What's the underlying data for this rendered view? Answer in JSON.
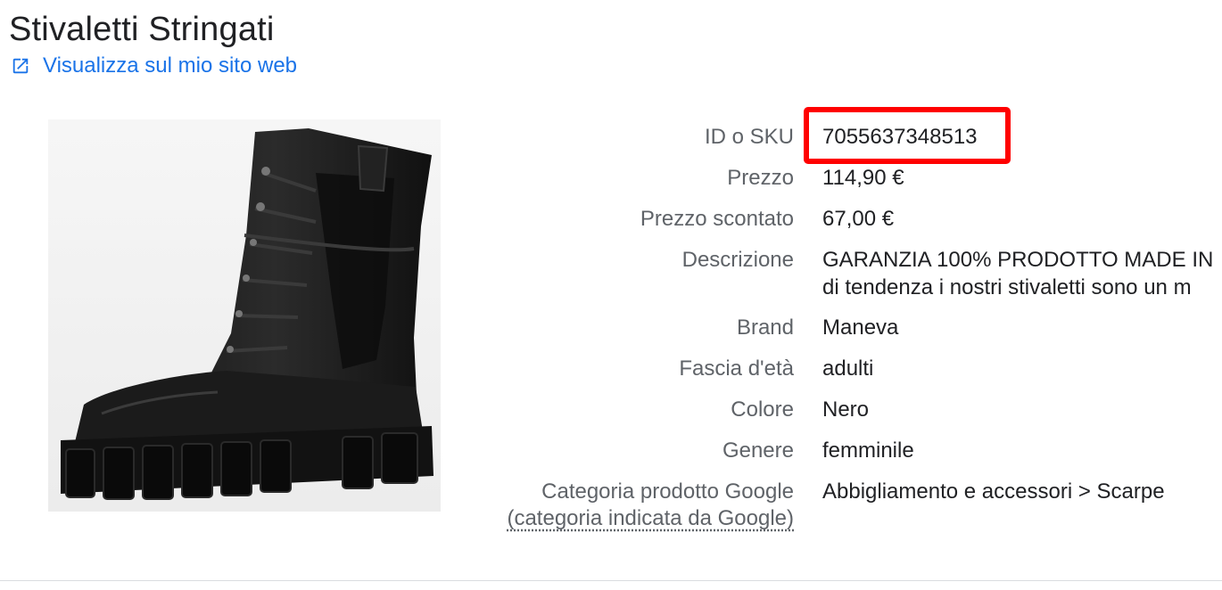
{
  "product": {
    "title": "Stivaletti Stringati",
    "view_link_label": "Visualizza sul mio sito web",
    "image_icon": "black-lace-up-boot-image"
  },
  "details": {
    "sku_label": "ID o SKU",
    "sku_value": "7055637348513",
    "price_label": "Prezzo",
    "price_value": "114,90 €",
    "sale_price_label": "Prezzo scontato",
    "sale_price_value": "67,00 €",
    "description_label": "Descrizione",
    "description_line1": "GARANZIA 100% PRODOTTO MADE IN",
    "description_line2": "di tendenza i nostri stivaletti sono un m",
    "brand_label": "Brand",
    "brand_value": "Maneva",
    "age_label": "Fascia d'età",
    "age_value": "adulti",
    "color_label": "Colore",
    "color_value": "Nero",
    "gender_label": "Genere",
    "gender_value": "femminile",
    "category_label": "Categoria prodotto Google",
    "category_sublabel": "(categoria indicata da Google)",
    "category_value": "Abbigliamento e accessori > Scarpe"
  },
  "colors": {
    "link": "#1a73e8",
    "highlight": "#ff0000",
    "label": "#5f6368",
    "value": "#202124"
  }
}
